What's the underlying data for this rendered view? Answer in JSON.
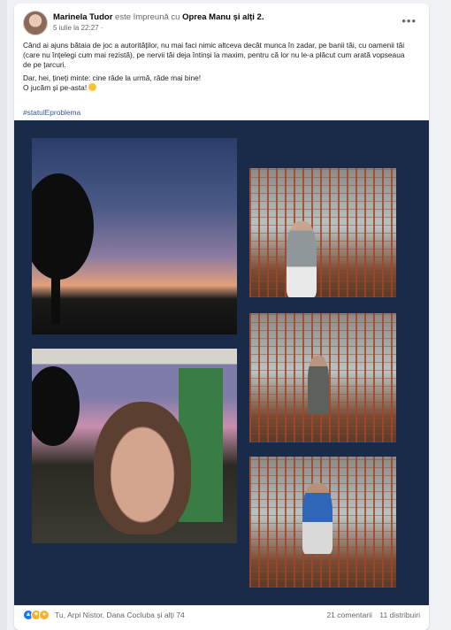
{
  "post": {
    "author": "Marinela Tudor",
    "with_text": "este împreună cu",
    "tagged": "Oprea Manu",
    "and_others": "și alți 2.",
    "date": "5 iulie la 22:27",
    "privacy_icon": "globe-icon",
    "more_icon": "more-dots-icon",
    "paragraph1": "Când ai ajuns bătaia de joc a autorităților, nu mai faci nimic altceva decât munca în zadar, pe banii tăi, cu oamenii tăi (care nu înțelegi cum mai rezistă), pe nervii tăi deja întinși la maxim, pentru că lor nu le-a plăcut cum arată vopseaua de pe țarcuri.",
    "paragraph2_line1": "Dar, hei, țineți minte: cine râde la urmă, râde mai bine!",
    "paragraph2_line2": "O jucăm și pe-asta!",
    "emoji": "smile-emoji",
    "hashtag": "#statulEproblema"
  },
  "photos": [
    {
      "name": "sunset-photo"
    },
    {
      "name": "cage-photo-1"
    },
    {
      "name": "cage-photo-2"
    },
    {
      "name": "selfie-photo"
    },
    {
      "name": "cage-photo-3"
    }
  ],
  "footer": {
    "reaction_icons": [
      "like-icon",
      "care-icon",
      "sad-icon"
    ],
    "reactors": "Tu, Arpi Nistor, Dana Cocluba și alți 74",
    "comments": "21 comentarii",
    "shares": "11 distribuiri"
  },
  "colors": {
    "photo_background": "#1a2b4a",
    "link": "#385898",
    "like": "#1877f2"
  }
}
